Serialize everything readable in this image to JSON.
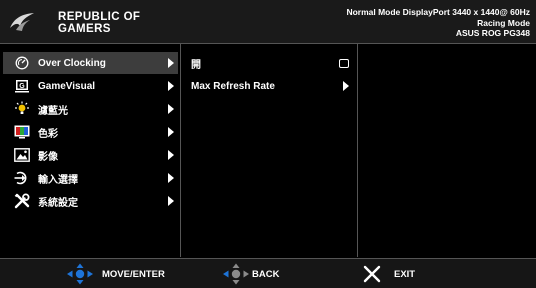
{
  "header": {
    "brand_line1": "REPUBLIC OF",
    "brand_line2": "GAMERS",
    "status_line1": "Normal Mode DisplayPort 3440 x 1440@ 60Hz",
    "status_line2": "Racing Mode",
    "status_line3": "ASUS ROG PG348"
  },
  "menu": {
    "items": [
      {
        "label": "Over Clocking",
        "icon": "speedometer-icon",
        "active": true
      },
      {
        "label": "GameVisual",
        "icon": "gamevisual-icon"
      },
      {
        "label": "濾藍光",
        "icon": "bluelight-icon"
      },
      {
        "label": "色彩",
        "icon": "color-icon"
      },
      {
        "label": "影像",
        "icon": "image-icon"
      },
      {
        "label": "輸入選擇",
        "icon": "input-icon"
      },
      {
        "label": "系統設定",
        "icon": "tools-icon"
      }
    ]
  },
  "submenu": {
    "items": [
      {
        "label": "開",
        "control": "checkbox"
      },
      {
        "label": "Max Refresh Rate",
        "control": "arrow"
      }
    ]
  },
  "footer": {
    "move_label": "MOVE/ENTER",
    "back_label": "BACK",
    "exit_label": "EXIT"
  },
  "colors": {
    "accent_blue": "#1e74d8",
    "active_row": "#3d3d3d",
    "background": "#000000"
  }
}
